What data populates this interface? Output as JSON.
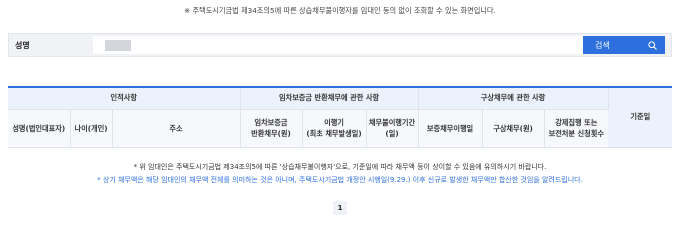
{
  "notice_top": "※ 주택도시기금법 제34조의5에 따른 상습채무불이행자를 임대인 동의 없이 조회할 수 있는 화면입니다.",
  "search": {
    "label": "성명",
    "value": "",
    "button_label": "검색",
    "button_icon": "search-icon"
  },
  "table": {
    "groups": {
      "identity": "인적사항",
      "deposit": "임차보증금 반환채무에 관한 사항",
      "indemnity": "구상채무에 관한 사항",
      "standard_date": "기준일"
    },
    "columns": {
      "name": "성명(법인대표자)",
      "age": "나이(개인)",
      "address": "주소",
      "deposit_debt": "임차보증금\n반환채무(원)",
      "period": "이행기\n(최초 채무발생일)",
      "nonfulfillment": "채무불이행기간\n(일)",
      "guarantee_date": "보증채무이행일",
      "indemnity_debt": "구상채무(원)",
      "enforcement": "강제집행 또는\n보전처분 신청횟수"
    }
  },
  "notes": {
    "note1": "* 위 임대인은 주택도시기금법 제34조의5에 따른 '상습채무불이행자'으로, 기준일에 따라 채무액 등이 상이할 수 있음에 유의하시기 바랍니다.",
    "note2": "* 상기 채무액은 해당 임대인의 채무액 전체를 의미하는 것은 아니며, 주택도시기금법 개정안 시행일(9.29.) 이후 신규로 발생한 채무액만 합산한 것임을 알려드립니다."
  },
  "pagination": {
    "current": "1"
  },
  "colors": {
    "accent": "#2e6fde",
    "header_bg": "#ecf2fb",
    "subheader_bg": "#f6f8fc",
    "search_bg": "#f0f2f5"
  }
}
